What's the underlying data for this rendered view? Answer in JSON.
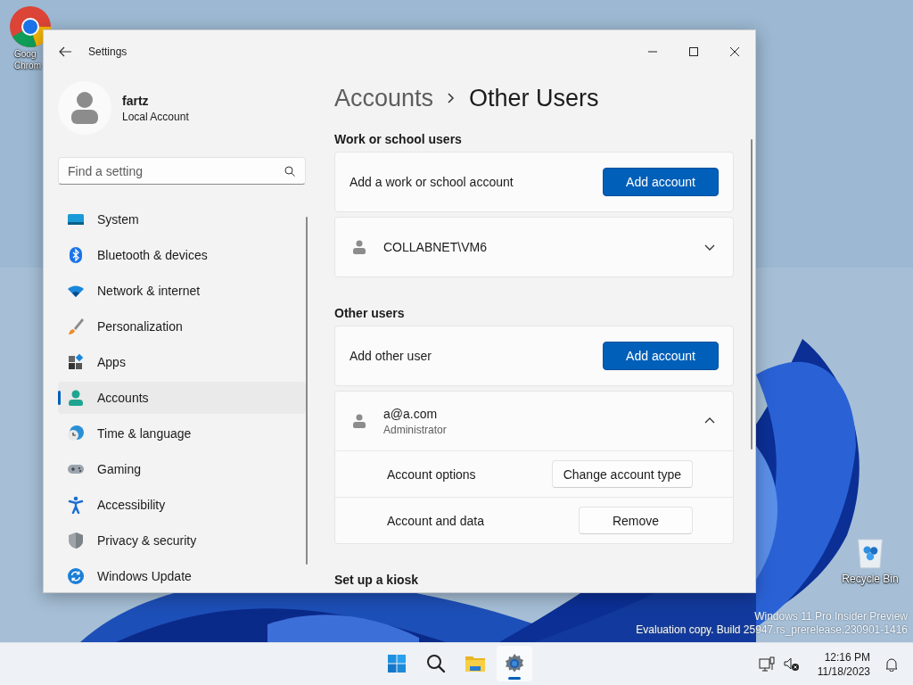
{
  "desktop": {
    "icons": [
      {
        "kind": "chrome",
        "label_lines": [
          "Goog",
          "Chrom"
        ]
      },
      {
        "kind": "recycle",
        "label_lines": [
          "Recycle Bin"
        ]
      }
    ],
    "watermark": [
      "Windows 11 Pro Insider Preview",
      "Evaluation copy. Build 25947.rs_prerelease.230901-1416"
    ]
  },
  "window": {
    "title": "Settings",
    "profile": {
      "name": "fartz",
      "account_type": "Local Account"
    },
    "search": {
      "placeholder": "Find a setting"
    },
    "nav": [
      {
        "label": "System",
        "kind": "system",
        "selected": false
      },
      {
        "label": "Bluetooth & devices",
        "kind": "bluetooth",
        "selected": false
      },
      {
        "label": "Network & internet",
        "kind": "wifi",
        "selected": false
      },
      {
        "label": "Personalization",
        "kind": "brush",
        "selected": false
      },
      {
        "label": "Apps",
        "kind": "apps",
        "selected": false
      },
      {
        "label": "Accounts",
        "kind": "person",
        "selected": true
      },
      {
        "label": "Time & language",
        "kind": "globe",
        "selected": false
      },
      {
        "label": "Gaming",
        "kind": "gamepad",
        "selected": false
      },
      {
        "label": "Accessibility",
        "kind": "accessibility",
        "selected": false
      },
      {
        "label": "Privacy & security",
        "kind": "shield",
        "selected": false
      },
      {
        "label": "Windows Update",
        "kind": "update",
        "selected": false
      }
    ],
    "breadcrumb": [
      "Accounts",
      "Other Users"
    ],
    "sections": [
      {
        "title": "Work or school users",
        "cards": [
          {
            "kind": "action",
            "label": "Add a work or school account",
            "button": "Add account"
          },
          {
            "kind": "user",
            "name": "COLLABNET\\VM6",
            "expanded": false
          }
        ]
      },
      {
        "title": "Other users",
        "cards": [
          {
            "kind": "action",
            "label": "Add other user",
            "button": "Add account"
          },
          {
            "kind": "user",
            "name": "a@a.com",
            "role": "Administrator",
            "expanded": true,
            "options": [
              {
                "label": "Account options",
                "button": "Change account type"
              },
              {
                "label": "Account and data",
                "button": "Remove"
              }
            ]
          }
        ]
      },
      {
        "title": "Set up a kiosk"
      }
    ]
  },
  "taskbar": {
    "apps": [
      {
        "kind": "start",
        "selected": false
      },
      {
        "kind": "search",
        "selected": false
      },
      {
        "kind": "folder",
        "selected": false
      },
      {
        "kind": "settings",
        "selected": true
      }
    ],
    "clock": {
      "time": "12:16 PM",
      "date": "11/18/2023"
    }
  }
}
